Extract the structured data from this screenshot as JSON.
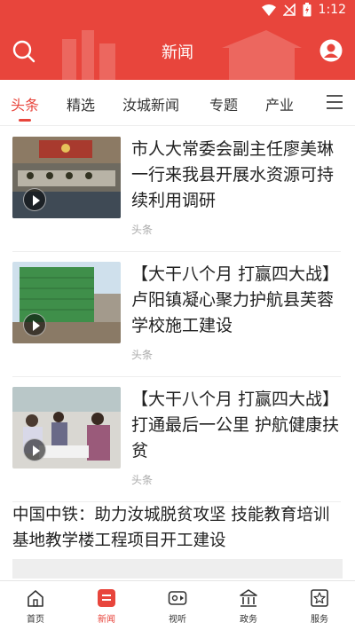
{
  "status_bar": {
    "time": "1:12"
  },
  "header": {
    "title": "新闻"
  },
  "tabs": [
    {
      "label": "头条",
      "active": true
    },
    {
      "label": "精选"
    },
    {
      "label": "汝城新闻"
    },
    {
      "label": "专题"
    },
    {
      "label": "产业"
    }
  ],
  "news": [
    {
      "title": "市人大常委会副主任廖美琳一行来我县开展水资源可持续利用调研",
      "tag": "头条",
      "has_video": true
    },
    {
      "title": "【大干八个月 打赢四大战】卢阳镇凝心聚力护航县芙蓉学校施工建设",
      "tag": "头条",
      "has_video": true
    },
    {
      "title": "【大干八个月 打赢四大战】打通最后一公里 护航健康扶贫",
      "tag": "头条",
      "has_video": true
    }
  ],
  "text_news": {
    "title": "中国中铁：助力汝城脱贫攻坚 技能教育培训基地教学楼工程项目开工建设"
  },
  "bottom_nav": [
    {
      "label": "首页",
      "icon": "home-icon"
    },
    {
      "label": "新闻",
      "icon": "news-icon",
      "active": true
    },
    {
      "label": "视听",
      "icon": "video-icon"
    },
    {
      "label": "政务",
      "icon": "government-icon"
    },
    {
      "label": "服务",
      "icon": "service-icon"
    }
  ],
  "colors": {
    "accent": "#e8453c",
    "muted": "#aaaaaa"
  }
}
